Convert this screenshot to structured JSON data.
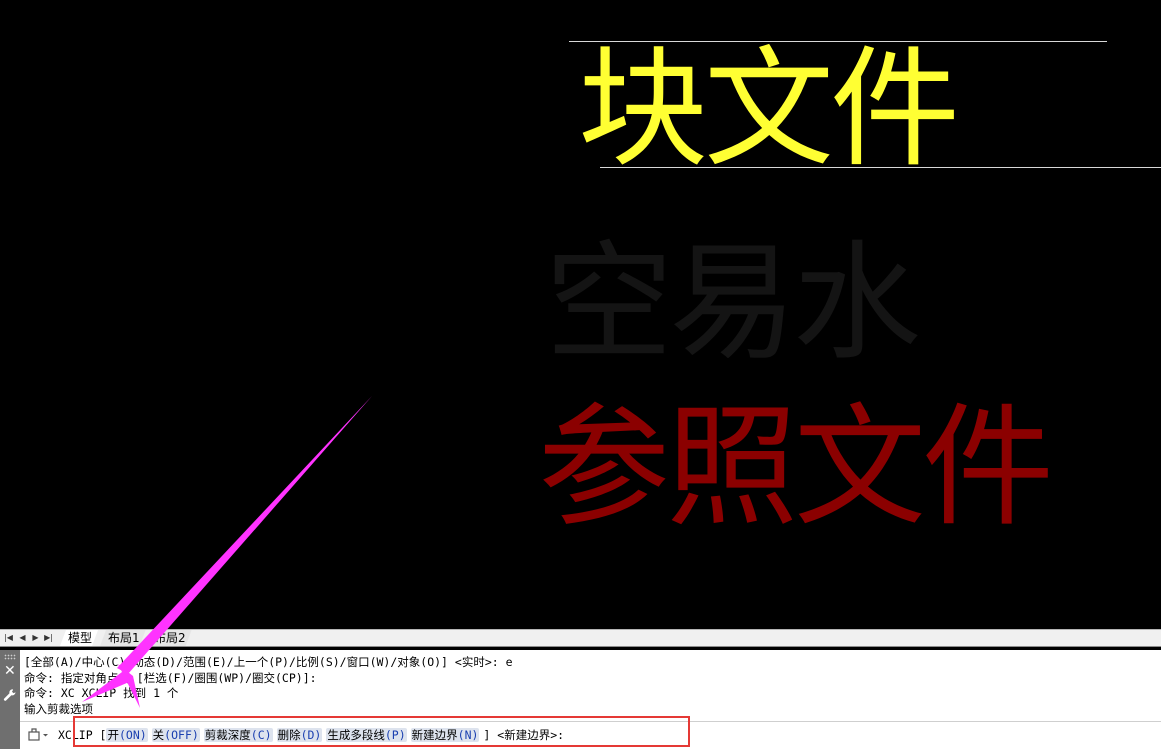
{
  "canvas": {
    "texts": {
      "block_file": "块文件",
      "watermark": "空易水",
      "xref_file": "参照文件"
    },
    "colors": {
      "block_file": "#ffff33",
      "watermark": "#141414",
      "xref_file": "#8b0000",
      "arrow": "#ff33ff"
    }
  },
  "layout_tabs": {
    "nav_buttons": [
      "|◀",
      "◀",
      "▶",
      "▶|"
    ],
    "tabs": [
      {
        "label": "模型",
        "active": true
      },
      {
        "label": "布局1",
        "active": false
      },
      {
        "label": "布局2",
        "active": false
      }
    ]
  },
  "command_line": {
    "history": [
      "[全部(A)/中心(C)/动态(D)/范围(E)/上一个(P)/比例(S)/窗口(W)/对象(O)] <实时>: e",
      "命令: 指定对角点或 [栏选(F)/圈围(WP)/圈交(CP)]:",
      "命令: XC XCLIP 找到 1 个",
      "输入剪裁选项"
    ],
    "prompt": {
      "command": "XCLIP [",
      "options": [
        {
          "label": "开",
          "key": "(ON)"
        },
        {
          "label": "关",
          "key": "(OFF)"
        },
        {
          "label": "剪裁深度",
          "key": "(C)"
        },
        {
          "label": "删除",
          "key": "(D)"
        },
        {
          "label": "生成多段线",
          "key": "(P)"
        },
        {
          "label": "新建边界",
          "key": "(N)"
        }
      ],
      "suffix": "] <新建边界>:"
    }
  }
}
